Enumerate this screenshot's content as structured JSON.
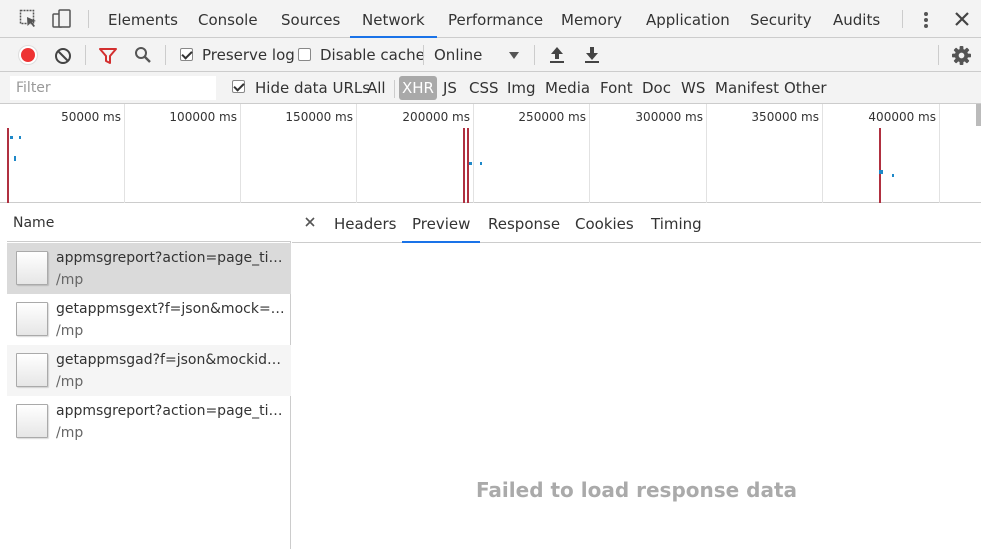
{
  "top_tabs": [
    "Elements",
    "Console",
    "Sources",
    "Network",
    "Performance",
    "Memory",
    "Application",
    "Security",
    "Audits"
  ],
  "active_tab": "Network",
  "toolbar": {
    "preserve_log_label": "Preserve log",
    "preserve_log_checked": true,
    "disable_cache_label": "Disable cache",
    "disable_cache_checked": false,
    "throttling_value": "Online"
  },
  "filter": {
    "placeholder": "Filter",
    "value": "",
    "hide_data_urls_label": "Hide data URLs",
    "hide_data_urls_checked": true,
    "types": [
      "All",
      "XHR",
      "JS",
      "CSS",
      "Img",
      "Media",
      "Font",
      "Doc",
      "WS",
      "Manifest",
      "Other"
    ],
    "active_type": "XHR"
  },
  "timeline": {
    "ticks": [
      "50000 ms",
      "100000 ms",
      "150000 ms",
      "200000 ms",
      "250000 ms",
      "300000 ms",
      "350000 ms",
      "400000 ms"
    ]
  },
  "requests": {
    "column_header": "Name",
    "rows": [
      {
        "name": "appmsgreport?action=page_time&__biz=...",
        "path": "/mp"
      },
      {
        "name": "getappmsgext?f=json&mock=&uin=...",
        "path": "/mp"
      },
      {
        "name": "getappmsgad?f=json&mockid=...",
        "path": "/mp"
      },
      {
        "name": "appmsgreport?action=page_time&__biz=...",
        "path": "/mp"
      }
    ]
  },
  "detail": {
    "tabs": [
      "Headers",
      "Preview",
      "Response",
      "Cookies",
      "Timing"
    ],
    "active_tab": "Preview",
    "message": "Failed to load response data"
  },
  "colors": {
    "accent": "#1a73e8",
    "record": "#e33333",
    "filter_icon": "#d32f2f",
    "timeline_marker_red": "#b03040",
    "timeline_marker_blue": "#1e88c8"
  }
}
